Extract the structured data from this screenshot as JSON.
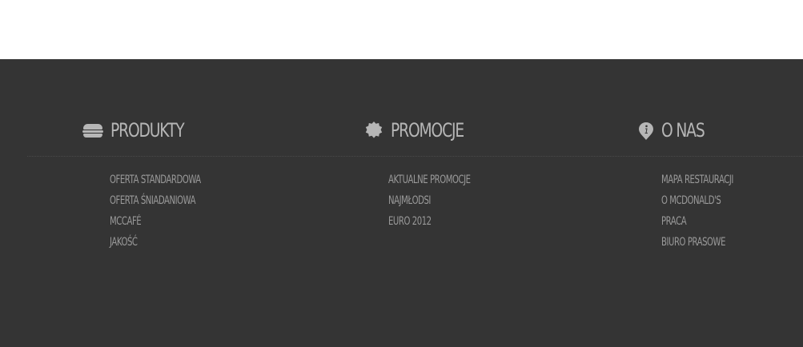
{
  "footer": {
    "columns": [
      {
        "id": "produkty",
        "icon": "burger-icon",
        "title": "PRODUKTY",
        "links": [
          "OFERTA STANDARDOWA",
          "OFERTA ŚNIADANIOWA",
          "MCCAFÉ",
          "JAKOŚĆ"
        ]
      },
      {
        "id": "promocje",
        "icon": "badge-icon",
        "title": "PROMOCJE",
        "links": [
          "AKTUALNE PROMOCJE",
          "NAJMŁODSI",
          "EURO 2012"
        ]
      },
      {
        "id": "onas",
        "icon": "info-pin-icon",
        "title": "O NAS",
        "links": [
          "MAPA RESTAURACJI",
          "O MCDONALD'S",
          "PRACA",
          "BIURO PRASOWE"
        ]
      }
    ]
  },
  "colors": {
    "footer_background": "#343434",
    "heading_text": "#b6b6b6",
    "link_text": "#9a9a9a",
    "top_background": "#ffffff"
  }
}
